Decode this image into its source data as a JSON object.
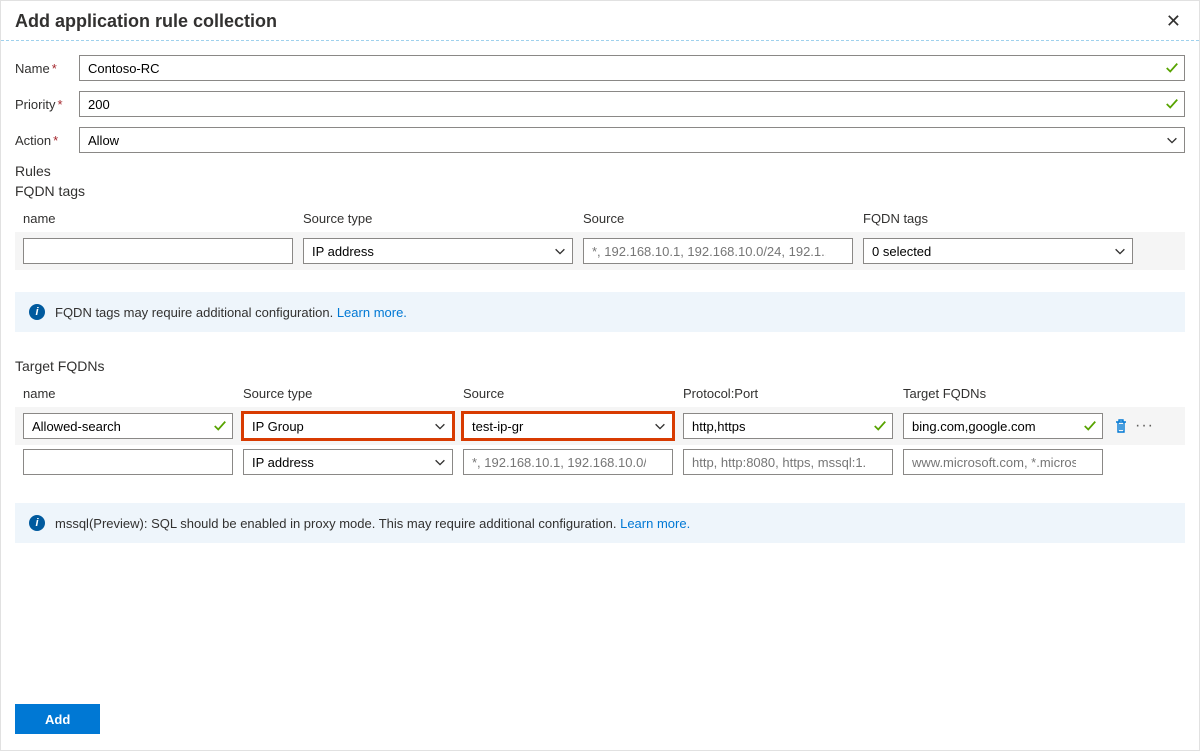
{
  "header": {
    "title": "Add application rule collection"
  },
  "fields": {
    "name_label": "Name",
    "name_value": "Contoso-RC",
    "priority_label": "Priority",
    "priority_value": "200",
    "action_label": "Action",
    "action_value": "Allow"
  },
  "rules_label": "Rules",
  "fqdn_tags": {
    "heading": "FQDN tags",
    "columns": {
      "name": "name",
      "source_type": "Source type",
      "source": "Source",
      "tags": "FQDN tags"
    },
    "row": {
      "name": "",
      "source_type": "IP address",
      "source_placeholder": "*, 192.168.10.1, 192.168.10.0/24, 192.1...",
      "tags_value": "0 selected"
    },
    "info_text": "FQDN tags may require additional configuration.",
    "learn_more": "Learn more."
  },
  "target_fqdns": {
    "heading": "Target FQDNs",
    "columns": {
      "name": "name",
      "source_type": "Source type",
      "source": "Source",
      "proto": "Protocol:Port",
      "targets": "Target FQDNs"
    },
    "rows": [
      {
        "name": "Allowed-search",
        "source_type": "IP Group",
        "source": "test-ip-gr",
        "proto": "http,https",
        "targets": "bing.com,google.com",
        "name_valid": true,
        "proto_valid": true,
        "targets_valid": true,
        "highlighted": true,
        "has_actions": true
      },
      {
        "name": "",
        "source_type": "IP address",
        "source_placeholder": "*, 192.168.10.1, 192.168.10.0/...",
        "proto_placeholder": "http, http:8080, https, mssql:1...",
        "targets_placeholder": "www.microsoft.com, *.micros...",
        "highlighted": false,
        "has_actions": false
      }
    ],
    "info_text": "mssql(Preview): SQL should be enabled in proxy mode. This may require additional configuration.",
    "learn_more": "Learn more."
  },
  "footer": {
    "add": "Add"
  }
}
